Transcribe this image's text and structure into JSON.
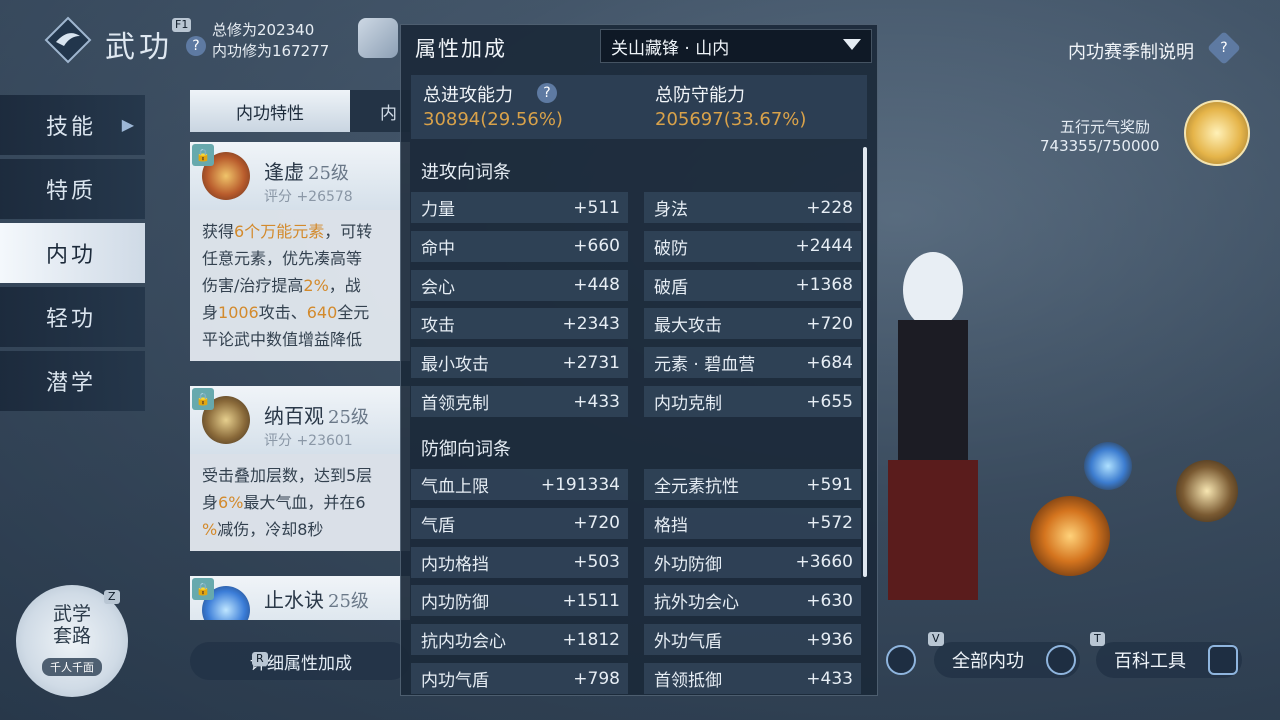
{
  "header": {
    "title": "武功",
    "f1_key": "F1",
    "help": "?",
    "total_cultivation": "总修为202340",
    "inner_cultivation": "内功修为167277"
  },
  "nav": {
    "items": [
      {
        "label": "技能"
      },
      {
        "label": "特质"
      },
      {
        "label": "内功"
      },
      {
        "label": "轻功"
      },
      {
        "label": "潜学"
      }
    ]
  },
  "mid": {
    "tab1": "内功特性",
    "tab2": "内",
    "skills": [
      {
        "name": "逢虚",
        "level": "25级",
        "score": "评分 +26578"
      },
      {
        "name": "纳百观",
        "level": "25级",
        "score": "评分 +23601"
      },
      {
        "name": "止水诀",
        "level": "25级"
      }
    ],
    "desc1": {
      "l1a": "获得",
      "l1b": "6个万能元素",
      "l1c": "，可转",
      "l2": "任意元素，优先凑高等",
      "l3a": "伤害/治疗提高",
      "l3b": "2%",
      "l3c": "，战",
      "l4a": "身",
      "l4b": "1006",
      "l4c": "攻击、",
      "l4d": "640",
      "l4e": "全元",
      "l5": "平论武中数值增益降低"
    },
    "desc2": {
      "l1": "受击叠加层数，达到5层",
      "l2a": "身",
      "l2b": "6%",
      "l2c": "最大气血，并在6",
      "l3a": "%",
      "l3b": "减伤，冷却8秒"
    },
    "detail_key": "R",
    "detail_label": "详细属性加成"
  },
  "wuxue": {
    "key": "Z",
    "label": "武学套路",
    "sub": "千人千面"
  },
  "popup": {
    "title": "属性加成",
    "dropdown": "关山藏锋 · 山内",
    "attack_label": "总进攻能力",
    "attack_value": "30894(29.56%)",
    "defense_label": "总防守能力",
    "defense_value": "205697(33.67%)",
    "attack_section": "进攻向词条",
    "defense_section": "防御向词条",
    "attack_stats": [
      {
        "name": "力量",
        "value": "+511"
      },
      {
        "name": "身法",
        "value": "+228"
      },
      {
        "name": "命中",
        "value": "+660"
      },
      {
        "name": "破防",
        "value": "+2444"
      },
      {
        "name": "会心",
        "value": "+448"
      },
      {
        "name": "破盾",
        "value": "+1368"
      },
      {
        "name": "攻击",
        "value": "+2343"
      },
      {
        "name": "最大攻击",
        "value": "+720"
      },
      {
        "name": "最小攻击",
        "value": "+2731"
      },
      {
        "name": "元素 · 碧血营",
        "value": "+684"
      },
      {
        "name": "首领克制",
        "value": "+433"
      },
      {
        "name": "内功克制",
        "value": "+655"
      }
    ],
    "defense_stats": [
      {
        "name": "气血上限",
        "value": "+191334"
      },
      {
        "name": "全元素抗性",
        "value": "+591"
      },
      {
        "name": "气盾",
        "value": "+720"
      },
      {
        "name": "格挡",
        "value": "+572"
      },
      {
        "name": "内功格挡",
        "value": "+503"
      },
      {
        "name": "外功防御",
        "value": "+3660"
      },
      {
        "name": "内功防御",
        "value": "+1511"
      },
      {
        "name": "抗外功会心",
        "value": "+630"
      },
      {
        "name": "抗内功会心",
        "value": "+1812"
      },
      {
        "name": "外功气盾",
        "value": "+936"
      },
      {
        "name": "内功气盾",
        "value": "+798"
      },
      {
        "name": "首领抵御",
        "value": "+433"
      }
    ]
  },
  "right": {
    "season_label": "内功赛季制说明",
    "season_help": "?",
    "reward_label": "五行元气奖励",
    "reward_count": "743355/750000",
    "btn_all_key": "V",
    "btn_all": "全部内功",
    "btn_wiki_key": "T",
    "btn_wiki": "百科工具"
  },
  "colors": {
    "highlight": "#d38a2c",
    "value_gold": "#d9a24a",
    "popup_bg": "#1b293a"
  }
}
